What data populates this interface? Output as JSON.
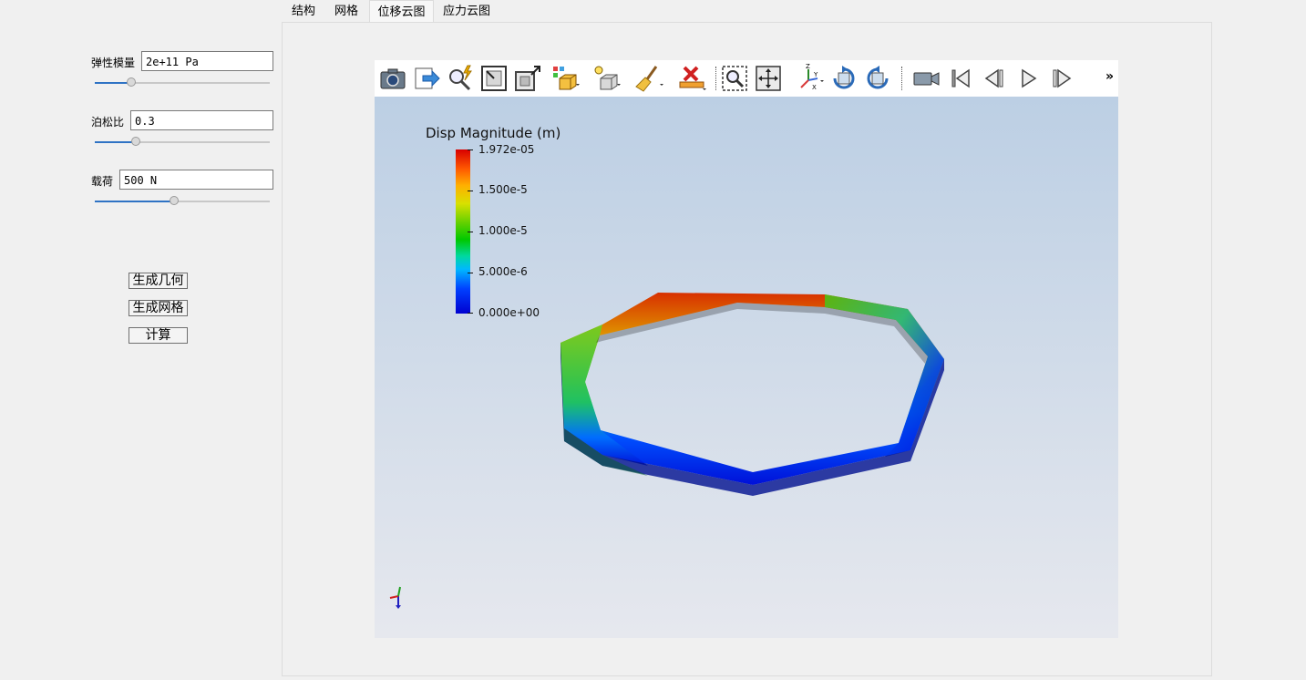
{
  "tabs": [
    "结构",
    "网格",
    "位移云图",
    "应力云图"
  ],
  "active_tab": 2,
  "params": {
    "elastic_modulus": {
      "label": "弹性模量",
      "value": "2e+11 Pa",
      "slider_fraction": 0.19
    },
    "poisson_ratio": {
      "label": "泊松比",
      "value": "0.3",
      "slider_fraction": 0.22
    },
    "load": {
      "label": "载荷",
      "value": "500 N",
      "slider_fraction": 0.45
    }
  },
  "buttons": {
    "generate_geometry": "生成几何",
    "generate_mesh": "生成网格",
    "compute": "计算"
  },
  "toolbar": {
    "icons": [
      "camera-icon",
      "export-icon",
      "interactive-select-icon",
      "reset-camera-icon",
      "zoom-to-box-icon",
      "cube-view-icon",
      "light-icon",
      "clear-icon",
      "delete-icon",
      "zoom-to-data-icon",
      "pan-center-icon",
      "axes-orientation-icon",
      "rotate-clockwise-icon",
      "rotate-counterclockwise-icon",
      "camera-video-icon",
      "first-frame-icon",
      "previous-frame-icon",
      "play-icon",
      "next-frame-icon"
    ],
    "more_label": "»"
  },
  "legend": {
    "title": "Disp Magnitude (m)",
    "ticks": [
      "1.972e-05",
      "1.500e-5",
      "1.000e-5",
      "5.000e-6",
      "0.000e+00"
    ],
    "colormap": [
      "#0000d0",
      "#00b8ff",
      "#00c800",
      "#d8e000",
      "#ff5a00",
      "#d80000"
    ]
  },
  "colors": {
    "accent": "#2f73c4",
    "background": "#f0f0f0"
  }
}
